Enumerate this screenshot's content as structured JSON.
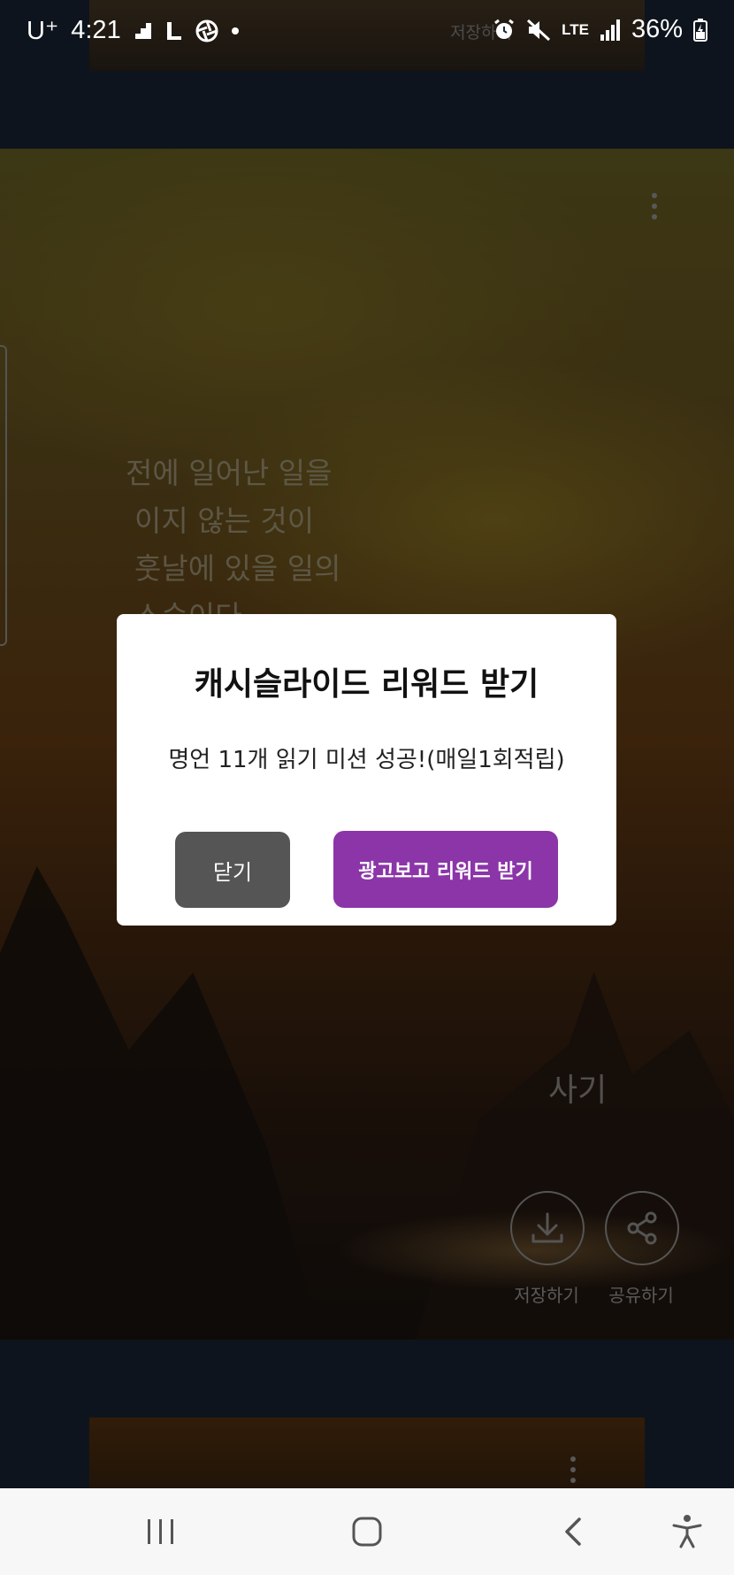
{
  "status_bar": {
    "carrier": "U⁺",
    "time": "4:21",
    "network": "LTE",
    "battery": "36%"
  },
  "background": {
    "top_card_faint_text": "저장하기",
    "quote_lines": [
      "전에 일어난 일을",
      "이지 않는 것이",
      "훗날에 있을 일의",
      "스승이다."
    ],
    "author_partial": "사기",
    "save_label": "저장하기",
    "share_label": "공유하기"
  },
  "dialog": {
    "title": "캐시슬라이드 리워드 받기",
    "message": "명언 11개 읽기 미션 성공!(매일1회적립)",
    "close_label": "닫기",
    "reward_label": "광고보고 리워드 받기"
  },
  "colors": {
    "reward_button": "#8b35a8",
    "close_button": "#555555"
  },
  "nav_bar": {
    "icons": [
      "recent-apps-icon",
      "home-icon",
      "back-icon",
      "accessibility-icon"
    ]
  }
}
